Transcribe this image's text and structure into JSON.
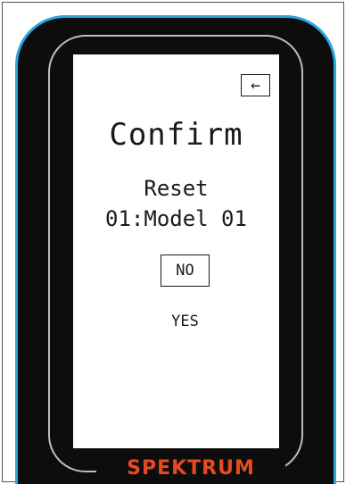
{
  "screen": {
    "title": "Confirm",
    "action": "Reset",
    "model": "01:Model 01",
    "back_icon": "back-arrow-icon",
    "back_glyph": "←"
  },
  "buttons": {
    "no_label": "NO",
    "yes_label": "YES"
  },
  "brand": {
    "logo_text": "SPEKTRUM"
  },
  "colors": {
    "bezel": "#0d0d0d",
    "bezel_outline": "#2aa6e0",
    "brand_orange": "#e8491f",
    "screen_bg": "#ffffff"
  }
}
